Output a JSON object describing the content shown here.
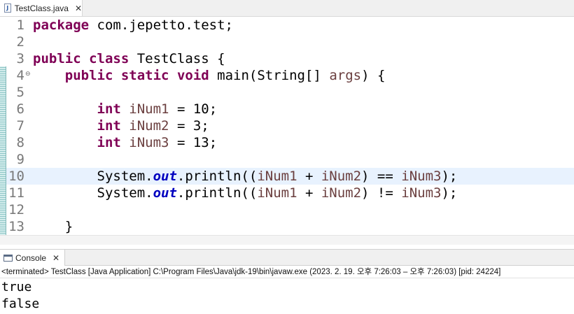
{
  "editor_tab": {
    "filename": "TestClass.java",
    "icon": "java-file-icon",
    "icon_glyph": "J",
    "close_glyph": "✕"
  },
  "code_lines": [
    {
      "number": "1",
      "tokens": [
        {
          "t": "package",
          "k": "kw"
        },
        {
          "t": " com.jepetto.test;"
        }
      ]
    },
    {
      "number": "2",
      "tokens": []
    },
    {
      "number": "3",
      "tokens": [
        {
          "t": "public",
          "k": "kw"
        },
        {
          "t": " "
        },
        {
          "t": "class",
          "k": "kw"
        },
        {
          "t": " TestClass {"
        }
      ]
    },
    {
      "number": "4",
      "fold": "⊖",
      "tokens": [
        {
          "t": "    "
        },
        {
          "t": "public",
          "k": "kw"
        },
        {
          "t": " "
        },
        {
          "t": "static",
          "k": "kw"
        },
        {
          "t": " "
        },
        {
          "t": "void",
          "k": "kw"
        },
        {
          "t": " main(String[] "
        },
        {
          "t": "args",
          "k": "param"
        },
        {
          "t": ") {"
        }
      ]
    },
    {
      "number": "5",
      "tokens": []
    },
    {
      "number": "6",
      "tokens": [
        {
          "t": "        "
        },
        {
          "t": "int",
          "k": "kw"
        },
        {
          "t": " "
        },
        {
          "t": "iNum1",
          "k": "var"
        },
        {
          "t": " = 10;"
        }
      ]
    },
    {
      "number": "7",
      "tokens": [
        {
          "t": "        "
        },
        {
          "t": "int",
          "k": "kw"
        },
        {
          "t": " "
        },
        {
          "t": "iNum2",
          "k": "var"
        },
        {
          "t": " = 3;"
        }
      ]
    },
    {
      "number": "8",
      "tokens": [
        {
          "t": "        "
        },
        {
          "t": "int",
          "k": "kw"
        },
        {
          "t": " "
        },
        {
          "t": "iNum3",
          "k": "var"
        },
        {
          "t": " = 13;"
        }
      ]
    },
    {
      "number": "9",
      "tokens": []
    },
    {
      "number": "10",
      "current": true,
      "tokens": [
        {
          "t": "        System."
        },
        {
          "t": "out",
          "k": "static-field"
        },
        {
          "t": ".println(("
        },
        {
          "t": "iNum1",
          "k": "var"
        },
        {
          "t": " + "
        },
        {
          "t": "iNum2",
          "k": "var"
        },
        {
          "t": ") == "
        },
        {
          "t": "iNum3",
          "k": "var"
        },
        {
          "t": ");"
        }
      ]
    },
    {
      "number": "11",
      "tokens": [
        {
          "t": "        System."
        },
        {
          "t": "out",
          "k": "static-field"
        },
        {
          "t": ".println(("
        },
        {
          "t": "iNum1",
          "k": "var"
        },
        {
          "t": " + "
        },
        {
          "t": "iNum2",
          "k": "var"
        },
        {
          "t": ") != "
        },
        {
          "t": "iNum3",
          "k": "var"
        },
        {
          "t": ");"
        }
      ]
    },
    {
      "number": "12",
      "tokens": []
    },
    {
      "number": "13",
      "tokens": [
        {
          "t": "    }"
        }
      ]
    }
  ],
  "syntax_colors": {
    "keyword": "#7f0055",
    "local_variable": "#6a3e3e",
    "static_field": "#0000c0",
    "line_number": "#787878",
    "current_line_bg": "#e8f2fe"
  },
  "console": {
    "tab_label": "Console",
    "icon": "console-icon",
    "close_glyph": "✕",
    "status": "<terminated> TestClass [Java Application] C:\\Program Files\\Java\\jdk-19\\bin\\javaw.exe  (2023. 2. 19. 오후 7:26:03 – 오후 7:26:03) [pid: 24224]",
    "output": [
      "true",
      "false"
    ]
  }
}
